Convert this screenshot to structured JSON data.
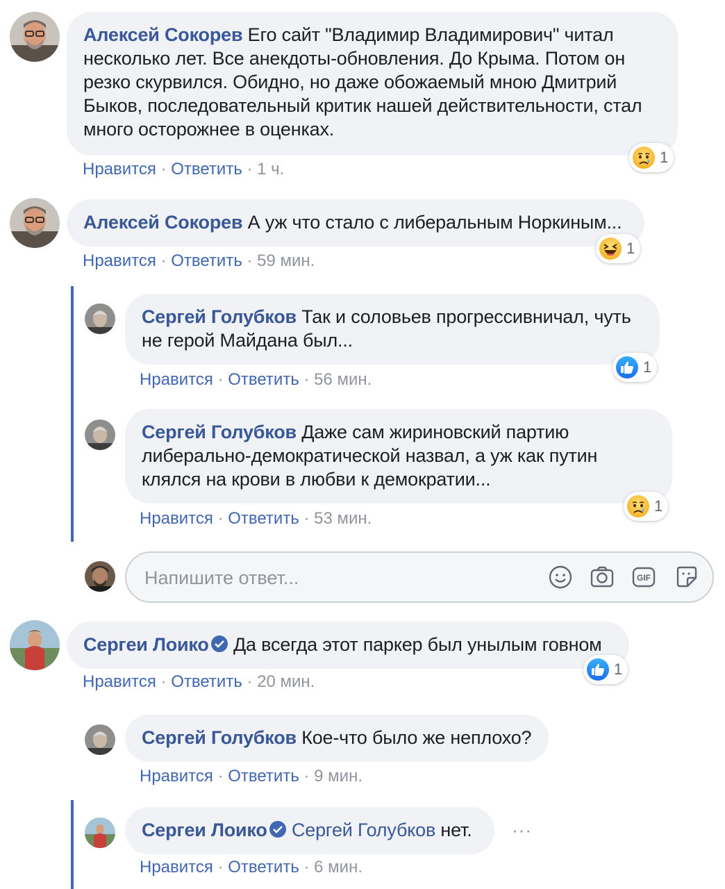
{
  "actions": {
    "like": "Нравится",
    "reply": "Ответить",
    "sep": " · "
  },
  "comments": [
    {
      "author": "Алексей Сокорев",
      "text": "Его сайт \"Владимир Владимирович\" читал несколько лет. Все анекдоты-обновления. До Крыма. Потом он резко скурвился. Обидно, но даже обожаемый мною Дмитрий Быков, последовательный критик нашей действительности, стал много осторожнее в оценках.",
      "time": "1 ч.",
      "reaction": {
        "icon": "sad-reaction-icon",
        "count": "1"
      }
    },
    {
      "author": "Алексей Сокорев",
      "text": "А уж что стало с либеральным Норкиным...",
      "time": "59 мин.",
      "reaction": {
        "icon": "haha-reaction-icon",
        "count": "1"
      }
    },
    {
      "author": "Сергей Голубков",
      "text": "Так и соловьев прогрессивничал, чуть не герой Майдана был...",
      "time": "56 мин.",
      "reaction": {
        "icon": "like-reaction-icon",
        "count": "1"
      }
    },
    {
      "author": "Сергей Голубков",
      "text": "Даже сам жириновский партию либерально-демократической назвал, а уж как путин клялся на крови в любви к демократии...",
      "time": "53 мин.",
      "reaction": {
        "icon": "sad-reaction-icon",
        "count": "1"
      }
    },
    {
      "author": "Сергеи Лоико",
      "verified": true,
      "text": "Да всегда этот паркер был унылым говном",
      "time": "20 мин.",
      "reaction": {
        "icon": "like-reaction-icon",
        "count": "1"
      }
    },
    {
      "author": "Сергей Голубков",
      "text": "Кое-что было же неплохо?",
      "time": "9 мин."
    },
    {
      "author": "Сергеи Лоико",
      "verified": true,
      "mention": "Сергей Голубков",
      "text": "нет.",
      "time": "6 мин.",
      "more": "···"
    }
  ],
  "reply_box": {
    "placeholder": "Напишите ответ...",
    "icons": [
      "emoji-icon",
      "camera-icon",
      "gif-icon",
      "sticker-icon"
    ],
    "gif_label": "GIF"
  },
  "colors": {
    "link": "#385898",
    "meta": "#90949c",
    "bubble": "#f0f2f5",
    "thread": "#4267b2"
  }
}
